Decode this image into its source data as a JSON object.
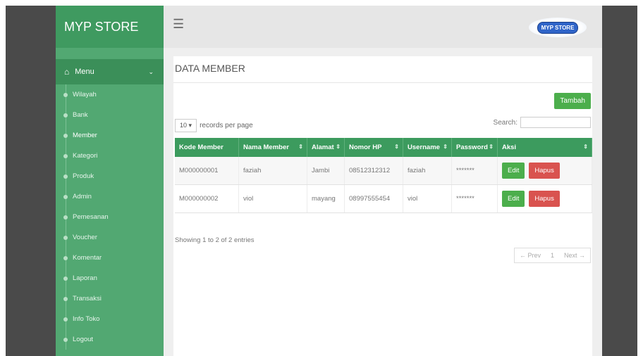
{
  "app": {
    "brand": "MYP STORE",
    "logo_text": "MYP STORE"
  },
  "sidebar": {
    "menu_label": "Menu",
    "items": [
      {
        "label": "Wilayah"
      },
      {
        "label": "Bank"
      },
      {
        "label": "Member"
      },
      {
        "label": "Kategori"
      },
      {
        "label": "Produk"
      },
      {
        "label": "Admin"
      },
      {
        "label": "Pemesanan"
      },
      {
        "label": "Voucher"
      },
      {
        "label": "Komentar"
      },
      {
        "label": "Laporan"
      },
      {
        "label": "Transaksi"
      },
      {
        "label": "Info Toko"
      },
      {
        "label": "Logout"
      }
    ],
    "active_index": 2
  },
  "page": {
    "title": "DATA MEMBER",
    "add_button": "Tambah",
    "records_per_page_value": "10",
    "records_per_page_label": "records per page",
    "search_label": "Search:",
    "search_value": ""
  },
  "table": {
    "headers": [
      "Kode Member",
      "Nama Member",
      "Alamat",
      "Nomor HP",
      "Username",
      "Password",
      "Aksi"
    ],
    "rows": [
      {
        "kode": "M000000001",
        "nama": "faziah",
        "alamat": "Jambi",
        "hp": "08512312312",
        "username": "faziah",
        "password": "*******"
      },
      {
        "kode": "M000000002",
        "nama": "viol",
        "alamat": "mayang",
        "hp": "08997555454",
        "username": "viol",
        "password": "*******"
      }
    ],
    "edit_label": "Edit",
    "delete_label": "Hapus"
  },
  "footer": {
    "info": "Showing 1 to 2 of 2 entries",
    "prev": "← Prev",
    "page": "1",
    "next": "Next →"
  },
  "colors": {
    "sidebar": "#52a872",
    "header_green": "#3c9b5e",
    "edit": "#4cae4c",
    "delete": "#d9534f"
  }
}
